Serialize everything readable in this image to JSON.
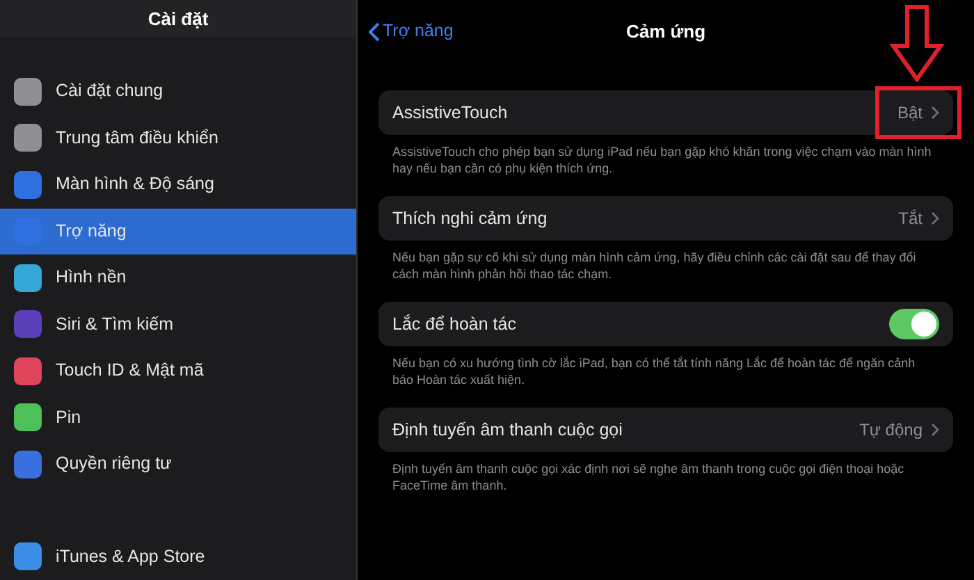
{
  "sidebar": {
    "title": "Cài đặt",
    "groups": [
      [
        {
          "label": "Cài đặt chung",
          "color": "#8e8e93",
          "selected": false
        },
        {
          "label": "Trung tâm điều khiển",
          "color": "#8e8e93",
          "selected": false
        },
        {
          "label": "Màn hình & Độ sáng",
          "color": "#2f6fe0",
          "selected": false
        },
        {
          "label": "Trợ năng",
          "color": "#2f6fe0",
          "selected": true
        },
        {
          "label": "Hình nền",
          "color": "#35a8d8",
          "selected": false
        },
        {
          "label": "Siri & Tìm kiếm",
          "color": "#5a3fb8",
          "selected": false
        },
        {
          "label": "Touch ID & Mật mã",
          "color": "#e0445a",
          "selected": false
        },
        {
          "label": "Pin",
          "color": "#4cc15a",
          "selected": false
        },
        {
          "label": "Quyền riêng tư",
          "color": "#3a6fe0",
          "selected": false
        }
      ],
      [
        {
          "label": "iTunes & App Store",
          "color": "#3a8ee6",
          "selected": false
        }
      ]
    ]
  },
  "detail": {
    "back": "Trợ năng",
    "title": "Cảm ứng",
    "rows": [
      {
        "kind": "value",
        "label": "AssistiveTouch",
        "value": "Bật",
        "highlighted": true,
        "footer": "AssistiveTouch cho phép bạn sử dụng iPad nếu bạn gặp khó khăn trong việc chạm vào màn hình hay nếu bạn cần có phụ kiện thích ứng."
      },
      {
        "kind": "value",
        "label": "Thích nghi cảm ứng",
        "value": "Tắt",
        "highlighted": false,
        "footer": "Nếu bạn gặp sự cố khi sử dụng màn hình cảm ứng, hãy điều chỉnh các cài đặt sau để thay đổi cách màn hình phản hồi thao tác chạm."
      },
      {
        "kind": "toggle",
        "label": "Lắc để hoàn tác",
        "on": true,
        "highlighted": false,
        "footer": "Nếu bạn có xu hướng tình cờ lắc iPad, bạn có thể tắt tính năng Lắc để hoàn tác để ngăn cảnh báo Hoàn tác xuất hiện."
      },
      {
        "kind": "value",
        "label": "Định tuyến âm thanh cuộc gọi",
        "value": "Tự động",
        "highlighted": false,
        "footer": "Định tuyến âm thanh cuộc gọi xác định nơi sẽ nghe âm thanh trong cuộc gọi điện thoại hoặc FaceTime âm thanh."
      }
    ]
  }
}
